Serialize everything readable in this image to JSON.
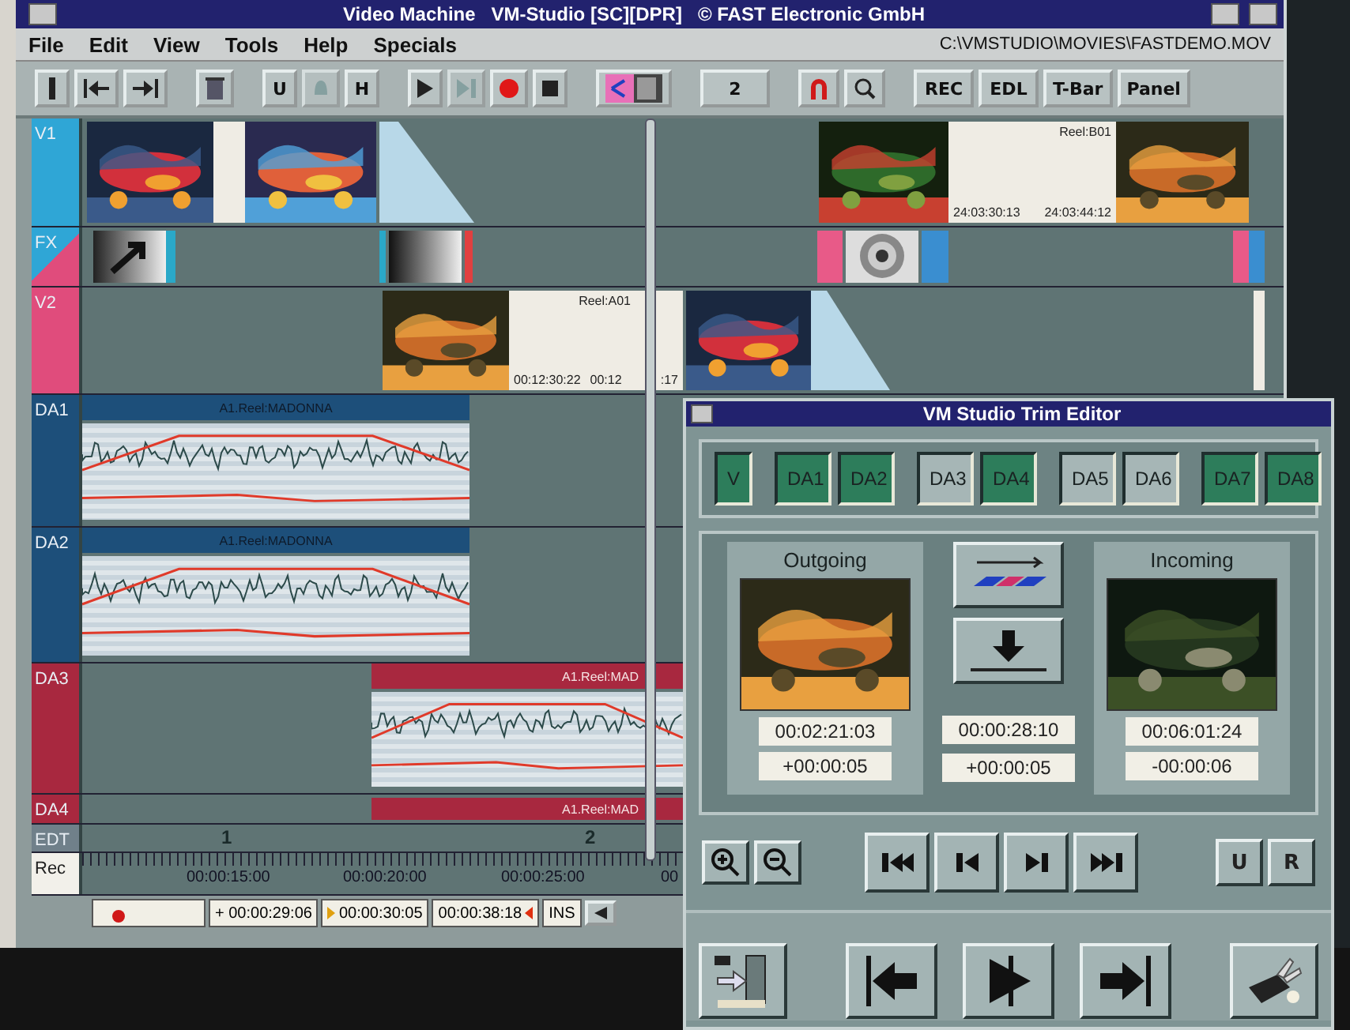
{
  "window": {
    "title": "Video Machine   VM-Studio [SC][DPR]   © FAST Electronic GmbH"
  },
  "menu": [
    {
      "label": "File"
    },
    {
      "label": "Edit"
    },
    {
      "label": "View"
    },
    {
      "label": "Tools"
    },
    {
      "label": "Help"
    },
    {
      "label": "Specials"
    }
  ],
  "file_path": "C:\\VMSTUDIO\\MOVIES\\FASTDEMO.MOV",
  "toolbar": [
    [
      {
        "kind": "icon",
        "disabled": false
      },
      {
        "kind": "icon",
        "disabled": false
      },
      {
        "kind": "icon",
        "disabled": false
      }
    ],
    [
      {
        "kind": "icon",
        "disabled": false
      }
    ],
    [
      {
        "kind": "text",
        "label": "U",
        "disabled": false
      },
      {
        "kind": "icon",
        "disabled": true
      },
      {
        "kind": "text",
        "label": "H",
        "disabled": false
      }
    ],
    [
      {
        "kind": "icon",
        "disabled": false
      },
      {
        "kind": "icon",
        "disabled": true
      },
      {
        "kind": "icon",
        "disabled": false
      },
      {
        "kind": "icon",
        "disabled": false
      }
    ],
    [
      {
        "kind": "icon",
        "disabled": false
      }
    ],
    [
      {
        "kind": "spin",
        "label": "2",
        "disabled": false
      }
    ],
    [
      {
        "kind": "icon",
        "disabled": false
      },
      {
        "kind": "icon",
        "disabled": false
      }
    ],
    [
      {
        "kind": "text",
        "label": "REC",
        "disabled": false
      },
      {
        "kind": "text",
        "label": "EDL",
        "disabled": false
      },
      {
        "kind": "text",
        "label": "T-Bar",
        "disabled": false
      },
      {
        "kind": "text",
        "label": "Panel",
        "disabled": false
      }
    ]
  ],
  "tracks": [
    {
      "label": "V1",
      "kind": "video",
      "color": "#2fa6d6",
      "items": [
        {
          "kind": "picture"
        },
        {
          "kind": "blank"
        },
        {
          "kind": "picture"
        },
        {
          "kind": "transition"
        },
        {
          "kind": "picture"
        },
        {
          "kind": "card",
          "reel": "Reel:B01",
          "timecodes": [
            "24:03:30:13",
            "24:03:44:12"
          ]
        },
        {
          "kind": "picture"
        }
      ]
    },
    {
      "label": "FX",
      "kind": "fx",
      "color": "#e04c7c",
      "items": [
        {
          "kind": "fx"
        },
        {
          "kind": "fx"
        },
        {
          "kind": "fx"
        },
        {
          "kind": "fx"
        }
      ]
    },
    {
      "label": "V2",
      "kind": "video",
      "color": "#e04c7c",
      "items": [
        {
          "kind": "picture"
        },
        {
          "kind": "card",
          "reel": "Reel:A01",
          "timecodes": [
            "00:12:30:22",
            "00:12",
            ":17"
          ]
        },
        {
          "kind": "picture"
        },
        {
          "kind": "transition"
        },
        {
          "kind": "blank"
        }
      ]
    },
    {
      "label": "DA1",
      "kind": "audio",
      "color": "#1d4f7a",
      "items": [
        {
          "kind": "audio",
          "title": "A1.Reel:MADONNA"
        }
      ]
    },
    {
      "label": "DA2",
      "kind": "audio",
      "color": "#1d4f7a",
      "items": [
        {
          "kind": "audio",
          "title": "A1.Reel:MADONNA"
        }
      ]
    },
    {
      "label": "DA3",
      "kind": "audio",
      "color": "#a8283f",
      "items": [
        {
          "kind": "audio",
          "title": "A1.Reel:MAD"
        }
      ]
    },
    {
      "label": "DA4",
      "kind": "bar",
      "color": "#a8283f",
      "items": [
        {
          "kind": "bar",
          "title": "A1.Reel:MAD"
        }
      ]
    },
    {
      "label": "EDT",
      "kind": "edit",
      "color": "#70808a",
      "items": [
        {
          "kind": "number",
          "label": "1"
        },
        {
          "kind": "number",
          "label": "2"
        }
      ]
    },
    {
      "label": "Rec",
      "kind": "rec",
      "color": "#f2f0ea",
      "items": [
        {
          "kind": "time",
          "label": "00:00:15:00"
        },
        {
          "kind": "time",
          "label": "00:00:20:00"
        },
        {
          "kind": "time",
          "label": "00:00:25:00"
        },
        {
          "kind": "time",
          "label": "00"
        }
      ]
    }
  ],
  "status": [
    "+ 00:00:29:06",
    "00:00:30:05",
    "00:00:38:18",
    "INS"
  ],
  "trim_editor": {
    "title": "VM Studio Trim Editor",
    "channels": [
      {
        "label": "V",
        "selected": true
      },
      {
        "label": "DA1",
        "selected": true
      },
      {
        "label": "DA2",
        "selected": true
      },
      {
        "label": "DA3",
        "selected": false
      },
      {
        "label": "DA4",
        "selected": true
      },
      {
        "label": "DA5",
        "selected": false
      },
      {
        "label": "DA6",
        "selected": false
      },
      {
        "label": "DA7",
        "selected": true
      },
      {
        "label": "DA8",
        "selected": true
      }
    ],
    "outgoing": {
      "title": "Outgoing",
      "timecode": "00:02:21:03",
      "offset": "+00:00:05"
    },
    "center": {
      "timecode": "00:00:28:10",
      "offset": "+00:00:05"
    },
    "incoming": {
      "title": "Incoming",
      "timecode": "00:06:01:24",
      "offset": "-00:00:06"
    },
    "buttons": [
      {
        "label": "U"
      },
      {
        "label": "R"
      }
    ]
  }
}
